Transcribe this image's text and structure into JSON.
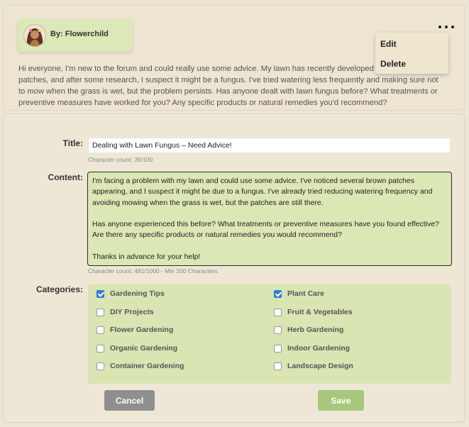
{
  "post": {
    "author_label": "By: Flowerchild",
    "menu_icon": "more-horizontal-icon",
    "menu_items": [
      "Edit",
      "Delete"
    ],
    "body": "Hi everyone, I'm new to the forum and could really use some advice. My lawn has recently developed some brown patches, and after some research, I suspect it might be a fungus. I've tried watering less frequently and making sure not to mow when the grass is wet, but the problem persists. Has anyone dealt with lawn fungus before? What treatments or preventive measures have worked for you? Any specific products or natural remedies you'd recommend?"
  },
  "form": {
    "title_label": "Title:",
    "title_value": "Dealing with Lawn Fungus – Need Advice!",
    "title_count": "Character count: 39/100",
    "content_label": "Content:",
    "content_paragraphs": [
      "I'm facing a problem with my lawn and could use some advice. I've noticed several brown patches appearing, and I suspect it might be due to a fungus. I've already tried reducing watering frequency and avoiding mowing when the grass is wet, but the patches are still there.",
      "Has anyone experienced this before? What treatments or preventive measures have you found effective? Are there any specific products or natural remedies you would recommend?",
      "Thanks in advance for your help!"
    ],
    "content_count": "Character count: 481/1000 - Min 200 Characters.",
    "categories_label": "Categories:",
    "categories": [
      {
        "label": "Gardening Tips",
        "checked": true
      },
      {
        "label": "Plant Care",
        "checked": true
      },
      {
        "label": "DIY Projects",
        "checked": false
      },
      {
        "label": "Fruit & Vegetables",
        "checked": false
      },
      {
        "label": "Flower Gardening",
        "checked": false
      },
      {
        "label": "Herb Gardening",
        "checked": false
      },
      {
        "label": "Organic Gardening",
        "checked": false
      },
      {
        "label": "Indoor Gardening",
        "checked": false
      },
      {
        "label": "Container Gardening",
        "checked": false
      },
      {
        "label": "Landscape Design",
        "checked": false
      }
    ],
    "cancel_label": "Cancel",
    "save_label": "Save"
  },
  "colors": {
    "accent_green": "#dbe7b4",
    "save_green": "#a6c77c",
    "cancel_gray": "#8f8f8f",
    "checkbox_blue": "#2f7ed8",
    "background": "#ece5d5"
  }
}
